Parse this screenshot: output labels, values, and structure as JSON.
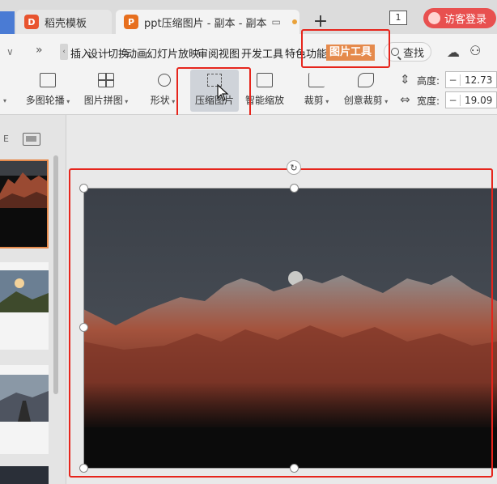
{
  "tabs": [
    {
      "label": "稻壳模板",
      "logo": "D"
    },
    {
      "label": "ppt压缩图片 - 副本 - 副本",
      "logo": "P"
    }
  ],
  "tabbar": {
    "plus": "+",
    "page_indicator": "1",
    "visitor_login": "访客登录"
  },
  "menu": {
    "items": [
      "插入",
      "设计",
      "切换",
      "动画",
      "幻灯片放映",
      "审阅",
      "视图",
      "开发工具",
      "特色功能"
    ],
    "active": "图片工具",
    "find": "查找"
  },
  "ribbon": {
    "buttons": [
      {
        "label": "多图轮播"
      },
      {
        "label": "图片拼图"
      },
      {
        "label": "形状"
      },
      {
        "label": "压缩图片"
      },
      {
        "label": "智能缩放"
      },
      {
        "label": "裁剪"
      },
      {
        "label": "创意裁剪"
      }
    ],
    "height_label": "高度:",
    "height_value": "12.73",
    "width_label": "宽度:",
    "width_value": "19.09"
  },
  "colors": {
    "accent_orange": "#e58a4c",
    "highlight_red": "#e6251c",
    "visitor_red": "#e8504f"
  }
}
